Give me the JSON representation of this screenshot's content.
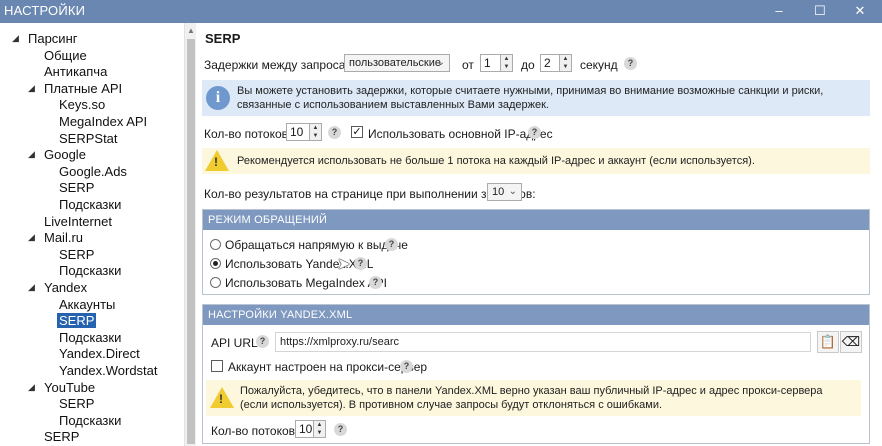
{
  "window": {
    "title": "НАСТРОЙКИ",
    "controls": {
      "minimize": "–",
      "maximize": "☐",
      "close": "✕"
    }
  },
  "tree": [
    {
      "id": "parsing",
      "label": "Парсинг",
      "level": 0,
      "expandable": true
    },
    {
      "id": "general",
      "label": "Общие",
      "level": 1
    },
    {
      "id": "anticaptcha",
      "label": "Антикапча",
      "level": 1
    },
    {
      "id": "paid-api",
      "label": "Платные API",
      "level": 1,
      "expandable": true
    },
    {
      "id": "keysso",
      "label": "Keys.so",
      "level": 2
    },
    {
      "id": "megaindex-api",
      "label": "MegaIndex API",
      "level": 2
    },
    {
      "id": "serpstat",
      "label": "SERPStat",
      "level": 2
    },
    {
      "id": "google",
      "label": "Google",
      "level": 1,
      "expandable": true
    },
    {
      "id": "google-ads",
      "label": "Google.Ads",
      "level": 2
    },
    {
      "id": "google-serp",
      "label": "SERP",
      "level": 2
    },
    {
      "id": "google-hints",
      "label": "Подсказки",
      "level": 2
    },
    {
      "id": "liveinternet",
      "label": "LiveInternet",
      "level": 1
    },
    {
      "id": "mailru",
      "label": "Mail.ru",
      "level": 1,
      "expandable": true
    },
    {
      "id": "mailru-serp",
      "label": "SERP",
      "level": 2
    },
    {
      "id": "mailru-hints",
      "label": "Подсказки",
      "level": 2
    },
    {
      "id": "yandex",
      "label": "Yandex",
      "level": 1,
      "expandable": true
    },
    {
      "id": "yandex-accounts",
      "label": "Аккаунты",
      "level": 2
    },
    {
      "id": "yandex-serp",
      "label": "SERP",
      "level": 2,
      "selected": true
    },
    {
      "id": "yandex-hints",
      "label": "Подсказки",
      "level": 2
    },
    {
      "id": "yandex-direct",
      "label": "Yandex.Direct",
      "level": 2
    },
    {
      "id": "yandex-wordstat",
      "label": "Yandex.Wordstat",
      "level": 2
    },
    {
      "id": "youtube",
      "label": "YouTube",
      "level": 1,
      "expandable": true
    },
    {
      "id": "youtube-serp",
      "label": "SERP",
      "level": 2
    },
    {
      "id": "youtube-hints",
      "label": "Подсказки",
      "level": 2
    },
    {
      "id": "serp",
      "label": "SERP",
      "level": 1
    }
  ],
  "content": {
    "header": "SERP",
    "delay": {
      "label": "Задержки между запросами:",
      "mode": "пользовательские",
      "from_label": "от",
      "from_value": "1",
      "to_label": "до",
      "to_value": "2",
      "unit": "секунд"
    },
    "info": "Вы можете установить задержки, которые считаете нужными, принимая во внимание возможные санкции и риски, связанные с использованием выставленных Вами задержек.",
    "threads": {
      "label": "Кол-во потоков:",
      "value": "10",
      "use_main_ip_label": "Использовать основной IP-адрес",
      "use_main_ip_checked": true
    },
    "threads_warning": "Рекомендуется использовать не больше 1 потока на каждый IP-адрес и аккаунт (если используется).",
    "results": {
      "label": "Кол-во результатов на странице при выполнении запросов:",
      "value": "10"
    },
    "request_mode": {
      "title": "РЕЖИМ ОБРАЩЕНИЙ",
      "options": [
        {
          "label": "Обращаться напрямую к выдаче",
          "selected": false
        },
        {
          "label": "Использовать Yandex.XML",
          "selected": true
        },
        {
          "label": "Использовать MegaIndex API",
          "selected": false
        }
      ]
    },
    "yandex_xml": {
      "title": "НАСТРОЙКИ YANDEX.XML",
      "api_url_label": "API URL:",
      "api_url_value": "https://xmlproxy.ru/searc",
      "proxy_label": "Аккаунт настроен на прокси-сервер",
      "proxy_checked": false,
      "warning": "Пожалуйста, убедитесь, что в панели Yandex.XML верно указан ваш публичный IP-адрес и адрес прокси-сервера (если используется). В противном случае запросы будут отклоняться с ошибками.",
      "threads_label": "Кол-во потоков:",
      "threads_value": "10"
    },
    "help_glyph": "?"
  }
}
